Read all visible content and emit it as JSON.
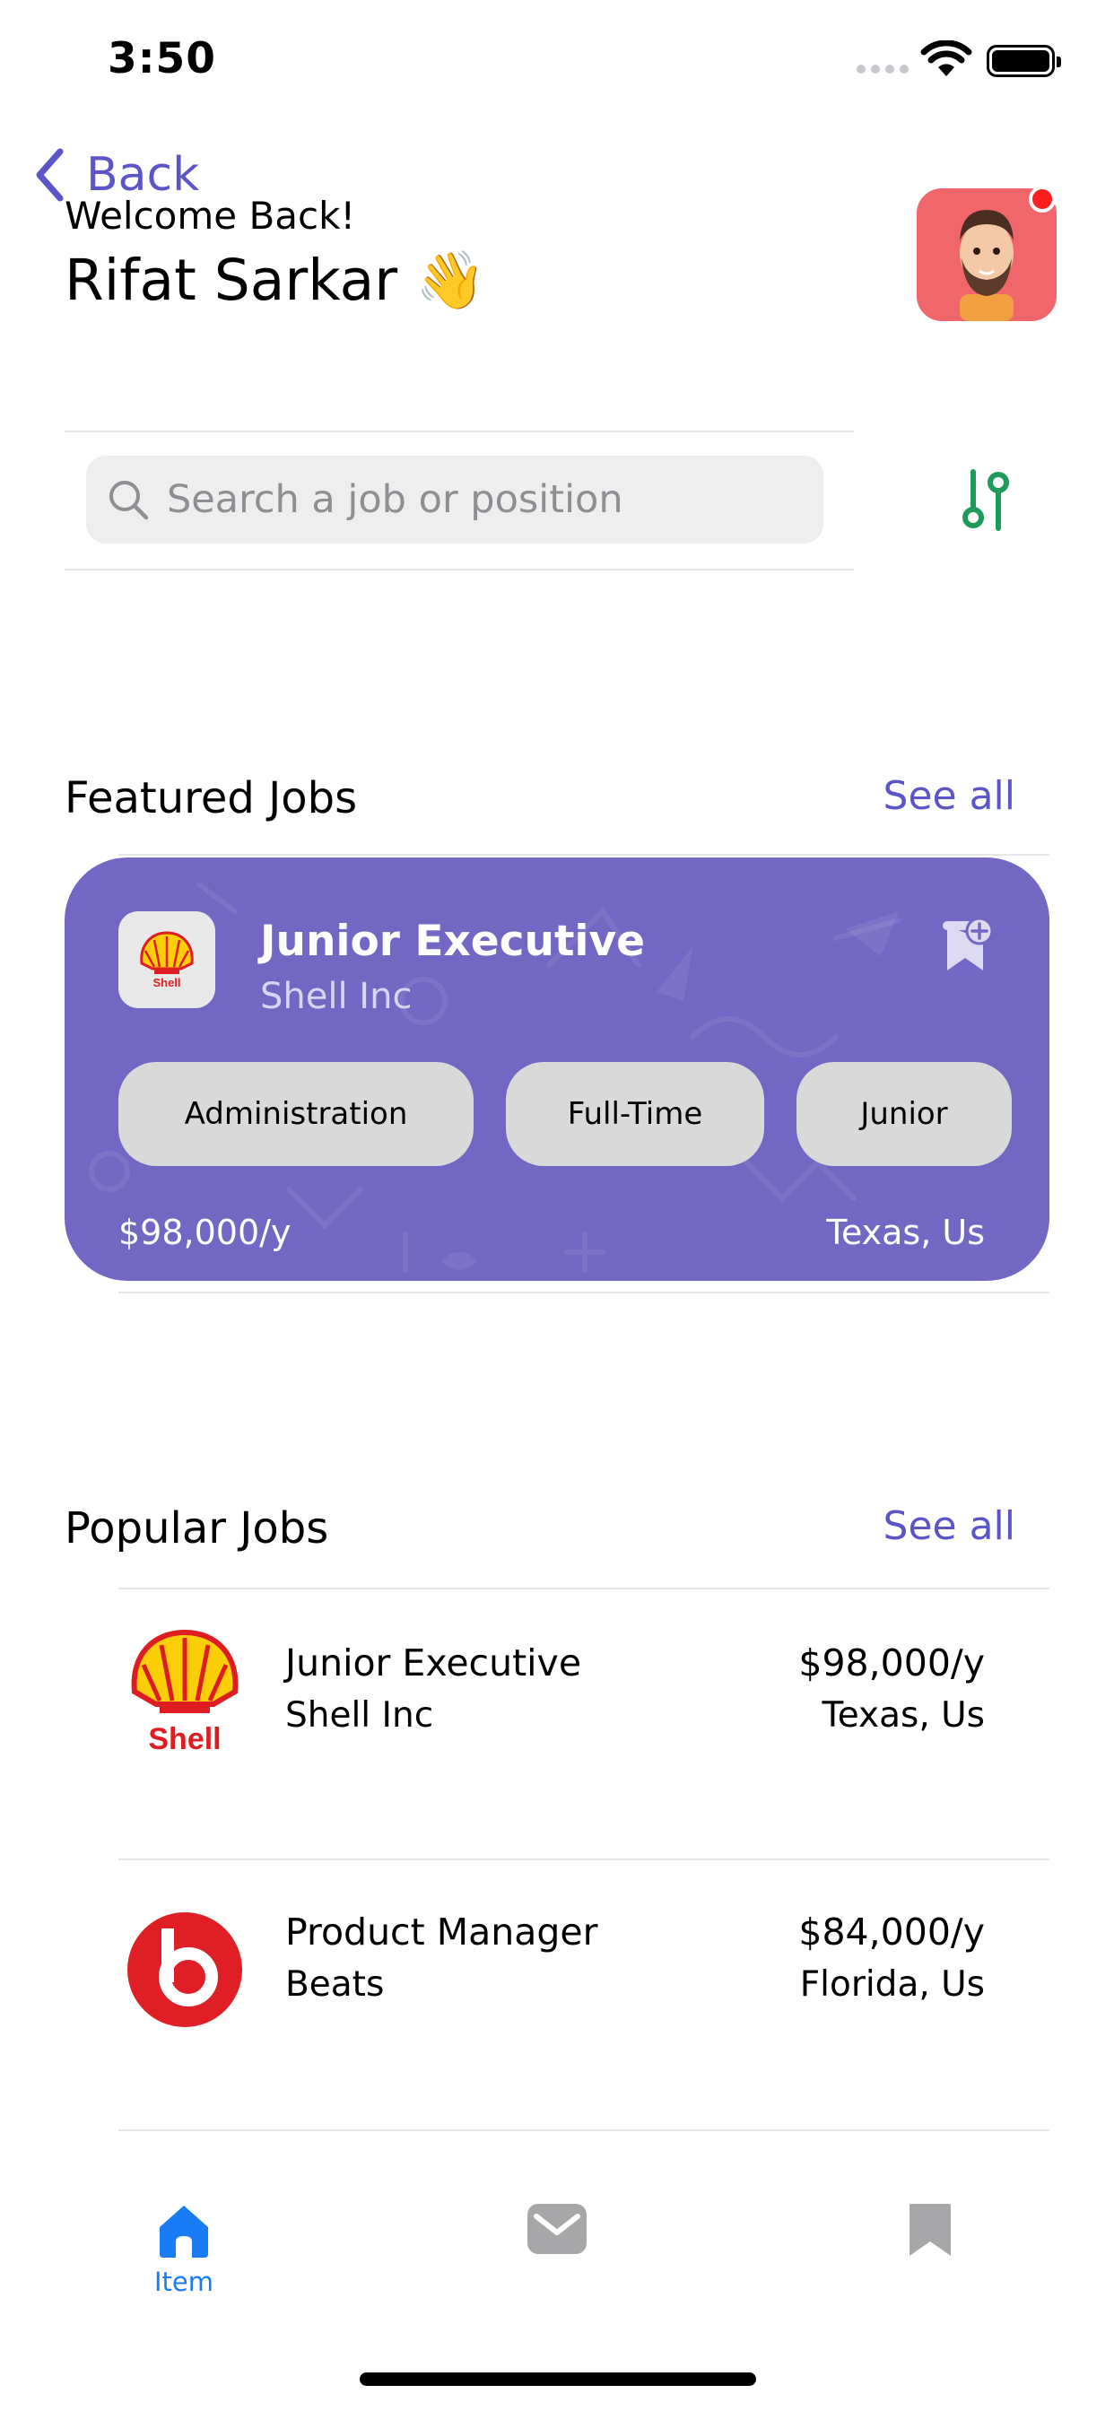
{
  "status_bar": {
    "time": "3:50"
  },
  "nav": {
    "back_label": "Back"
  },
  "header": {
    "welcome": "Welcome Back!",
    "user_name": "Rifat Sarkar",
    "wave_emoji": "👋"
  },
  "search": {
    "placeholder": "Search a job or position",
    "value": ""
  },
  "featured": {
    "title": "Featured Jobs",
    "see_all": "See all",
    "card": {
      "job_title": "Junior Executive",
      "company": "Shell Inc",
      "logo_text": "Shell",
      "tags": [
        "Administration",
        "Full-Time",
        "Junior"
      ],
      "salary": "$98,000/y",
      "location": "Texas, Us",
      "background_color": "#7367c4"
    }
  },
  "popular": {
    "title": "Popular Jobs",
    "see_all": "See all",
    "items": [
      {
        "job_title": "Junior Executive",
        "company": "Shell Inc",
        "salary": "$98,000/y",
        "location": "Texas, Us",
        "logo": "shell-logo",
        "logo_text": "Shell"
      },
      {
        "job_title": "Product Manager",
        "company": "Beats",
        "salary": "$84,000/y",
        "location": "Florida, Us",
        "logo": "beats-logo"
      }
    ]
  },
  "tabbar": {
    "tabs": [
      {
        "label": "Item",
        "icon": "home-icon",
        "active": true
      },
      {
        "label": "",
        "icon": "mail-icon",
        "active": false
      },
      {
        "label": "",
        "icon": "bookmark-icon",
        "active": false
      }
    ]
  },
  "colors": {
    "accent": "#5b55c9",
    "tab_active": "#1a7cf4",
    "card": "#7367c4",
    "avatar_bg": "#f0666b",
    "filter": "#1e9a5a"
  }
}
